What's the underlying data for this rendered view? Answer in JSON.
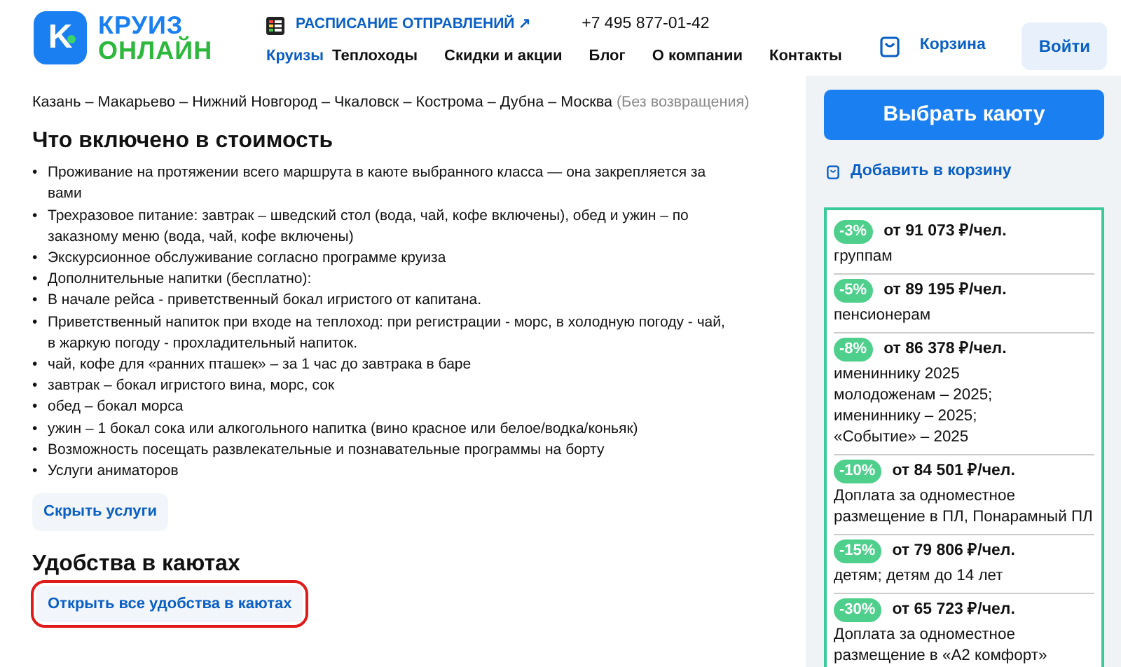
{
  "logo": {
    "mark": "K",
    "line1": "КРУИЗ",
    "line2": "ОНЛАЙН"
  },
  "schedule_link": "РАСПИСАНИЕ ОТПРАВЛЕНИЙ ↗",
  "phone": "+7 495 877-01-42",
  "nav": [
    {
      "label": "Круизы",
      "selected": true
    },
    {
      "label": "Теплоходы",
      "selected": false
    },
    {
      "label": "Скидки и акции",
      "selected": false
    },
    {
      "label": "Блог",
      "selected": false
    },
    {
      "label": "О компании",
      "selected": false
    },
    {
      "label": "Контакты",
      "selected": false
    }
  ],
  "cart": "Корзина",
  "login": "Войти",
  "route": {
    "text": "Казань – Макарьево – Нижний Новгород – Чкаловск – Кострома – Дубна – Москва",
    "note": "(Без возвращения)"
  },
  "included": {
    "title": "Что включено в стоимость",
    "bullet": "•",
    "items": [
      "Проживание на протяжении всего маршрута в каюте выбранного класса — она закрепляется за вами",
      "Трехразовое питание: завтрак – шведский стол (вода, чай, кофе включены), обед и ужин – по заказному меню (вода, чай, кофе включены)",
      "Экскурсионное обслуживание согласно программе круиза",
      "Дополнительные напитки (бесплатно):",
      "В начале рейса - приветственный бокал игристого от капитана.",
      "Приветственный напиток при входе на теплоход: при регистрации - морс, в холодную погоду - чай, в жаркую погоду - прохладительный напиток.",
      "чай, кофе для «ранних пташек» – за 1 час до завтрака в баре",
      "завтрак – бокал игристого вина, морс, сок",
      "обед – бокал морса",
      "ужин – 1 бокал сока или алкогольного напитка (вино красное или белое/водка/коньяк)",
      "Возможность посещать развлекательные и познавательные программы на борту",
      "Услуги аниматоров"
    ],
    "toggle": "Скрыть услуги"
  },
  "amenities": {
    "title": "Удобства в каютах",
    "button": "Открыть все удобства в каютах",
    "highlighted": true
  },
  "sidebar": {
    "choose_button": "Выбрать каюту",
    "add_to_cart": "Добавить в корзину",
    "discounts": [
      {
        "badge": "-3%",
        "price": "от 91 073 ₽/чел.",
        "lines": [
          "группам"
        ]
      },
      {
        "badge": "-5%",
        "price": "от 89 195 ₽/чел.",
        "lines": [
          "пенсионерам"
        ]
      },
      {
        "badge": "-8%",
        "price": "от 86 378 ₽/чел.",
        "lines": [
          "имениннику 2025",
          "молодоженам – 2025;",
          "имениннику – 2025;",
          "«Событие» – 2025"
        ]
      },
      {
        "badge": "-10%",
        "price": "от 84 501 ₽/чел.",
        "lines": [
          "Доплата за одноместное",
          "размещение в ПЛ, Понарамный ПЛ"
        ]
      },
      {
        "badge": "-15%",
        "price": "от 79 806 ₽/чел.",
        "lines": [
          "детям; детям до 14 лет"
        ]
      },
      {
        "badge": "-30%",
        "price": "от 65 723 ₽/чел.",
        "lines": [
          "Доплата за одноместное",
          "размещение в «А2 комфорт»"
        ]
      }
    ]
  }
}
